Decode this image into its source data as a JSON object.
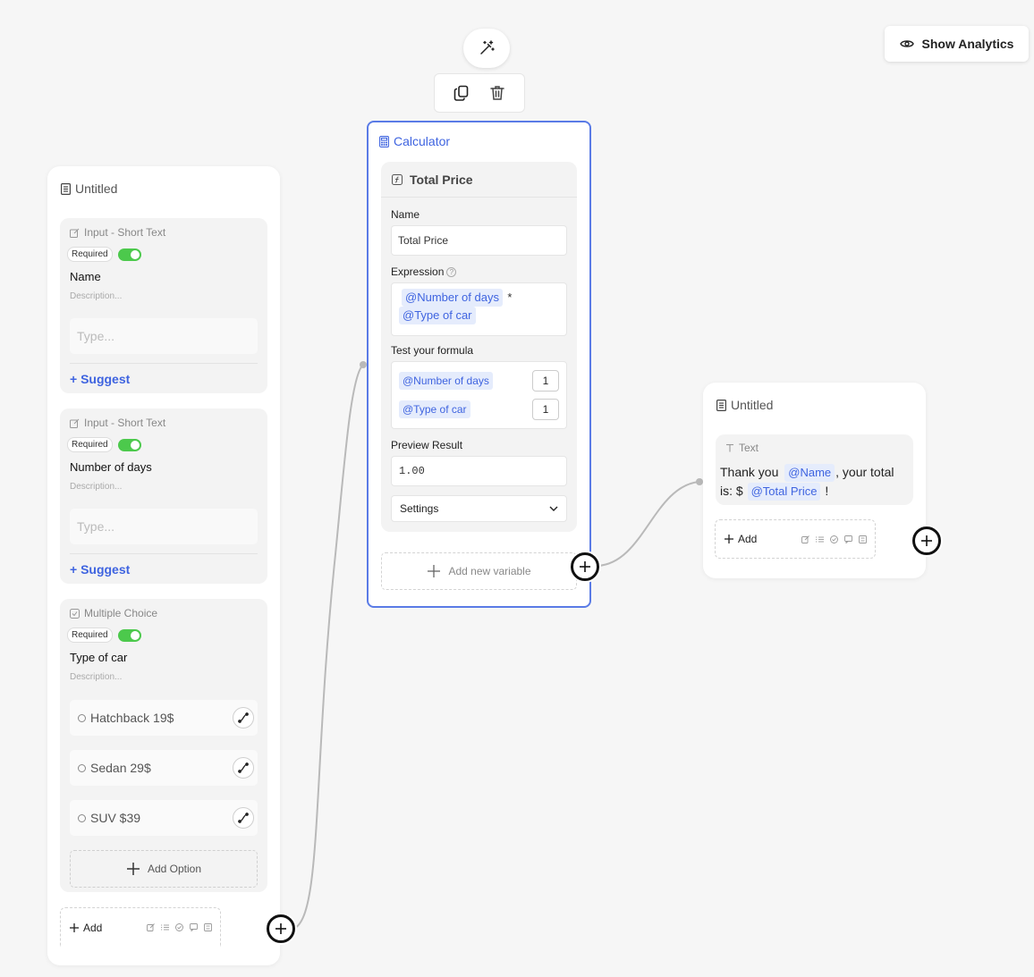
{
  "toolbar": {
    "magic_icon": "magic-wand-icon",
    "copy_icon": "copy-icon",
    "delete_icon": "trash-icon",
    "analytics_label": "Show Analytics"
  },
  "left_card": {
    "title": "Untitled",
    "blocks": [
      {
        "type_label": "Input - Short Text",
        "required_label": "Required",
        "question": "Name",
        "description_placeholder": "Description...",
        "input_placeholder": "Type...",
        "suggest_label": "+ Suggest"
      },
      {
        "type_label": "Input - Short Text",
        "required_label": "Required",
        "question": "Number of days",
        "description_placeholder": "Description...",
        "input_placeholder": "Type...",
        "suggest_label": "+ Suggest"
      },
      {
        "type_label": "Multiple Choice",
        "required_label": "Required",
        "question": "Type of car",
        "description_placeholder": "Description...",
        "options": [
          "Hatchback 19$",
          "Sedan 29$",
          "SUV $39"
        ],
        "add_option_label": "Add Option"
      }
    ],
    "add_label": "Add"
  },
  "calculator": {
    "title": "Calculator",
    "variable_name": "Total Price",
    "name_label": "Name",
    "name_value": "Total Price",
    "expression_label": "Expression",
    "expression_tag_1": "@Number of days",
    "expression_operator": "*",
    "expression_tag_2": "@Type of car",
    "test_label": "Test your formula",
    "test_inputs": [
      {
        "tag": "@Number of days",
        "value": "1"
      },
      {
        "tag": "@Type of car",
        "value": "1"
      }
    ],
    "preview_label": "Preview Result",
    "preview_value": "1.00",
    "settings_label": "Settings",
    "add_variable_label": "Add new variable"
  },
  "right_card": {
    "title": "Untitled",
    "block_type": "Text",
    "text_part1": "Thank you",
    "tag_name": "@Name",
    "text_part2": ", your total is: $",
    "tag_total": "@Total Price",
    "text_part3": "!",
    "add_label": "Add"
  },
  "colors": {
    "accent": "#3f64e0",
    "selected_border": "#5a7be6",
    "toggle_on": "#4cc94c",
    "tag_bg": "#e5ecfc"
  }
}
